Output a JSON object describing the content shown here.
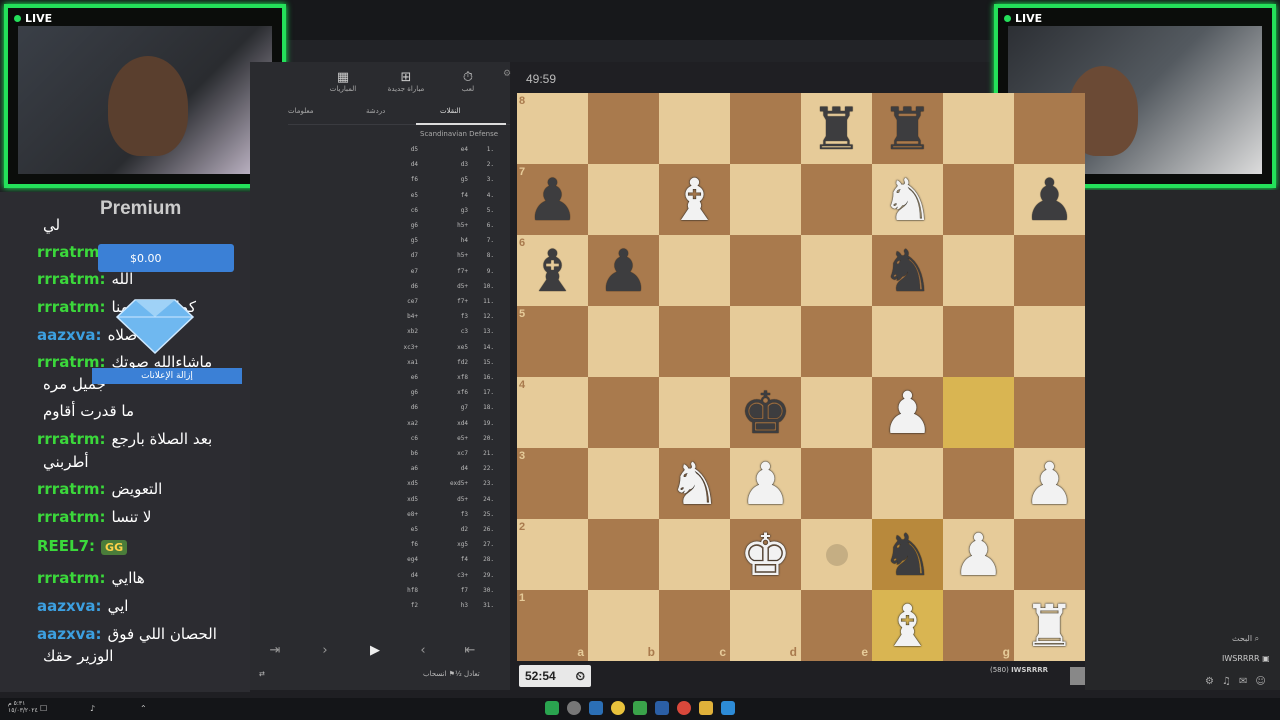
{
  "stream": {
    "live_label": "LIVE",
    "premium_label": "Premium"
  },
  "chat": {
    "messages": [
      {
        "user": "",
        "text": "لي"
      },
      {
        "user": "rrratrm:",
        "text": "تعويض"
      },
      {
        "user": "rrratrm:",
        "text": "الله"
      },
      {
        "user": "rrratrm:",
        "text": "كمل لا تحرمنا"
      },
      {
        "user": "aazxva:",
        "text": "صلاه"
      },
      {
        "user": "rrratrm:",
        "text": "ماشاءالله صوتك"
      },
      {
        "user": "",
        "text": "جميل مره"
      },
      {
        "user": "",
        "text": "ما قدرت أقاوم"
      },
      {
        "user": "rrratrm:",
        "text": "بعد الصلاة بارجع"
      },
      {
        "user": "",
        "text": "أطربني"
      },
      {
        "user": "rrratrm:",
        "text": "التعويض"
      },
      {
        "user": "rrratrm:",
        "text": "لا تنسا"
      },
      {
        "user": "REEL7:",
        "text": "GG"
      },
      {
        "user": "rrratrm:",
        "text": "هاايي"
      },
      {
        "user": "aazxva:",
        "text": "ايي"
      },
      {
        "user": "aazxva:",
        "text": "الحصان اللي فوق"
      },
      {
        "user": "",
        "text": "الوزير حقك"
      }
    ],
    "ad_price": "$0.00",
    "ad_remove": "إزالة الإعلانات"
  },
  "panel": {
    "tabs": [
      {
        "label": "لعب",
        "icon": "timer-icon"
      },
      {
        "label": "مباراة جديدة",
        "icon": "plus-icon"
      },
      {
        "label": "المباريات",
        "icon": "grid-icon"
      }
    ],
    "subtabs": [
      "النقلات",
      "دردشة",
      "معلومات"
    ],
    "opening": "Scandinavian Defense",
    "moves": [
      {
        "n": "1.",
        "w": "e4",
        "b": "d5"
      },
      {
        "n": "2.",
        "w": "d3",
        "b": "d4"
      },
      {
        "n": "3.",
        "w": "g5",
        "b": "f6"
      },
      {
        "n": "4.",
        "w": "f4",
        "b": "e5"
      },
      {
        "n": "5.",
        "w": "g3",
        "b": "c6"
      },
      {
        "n": "6.",
        "w": "h5+",
        "b": "g6"
      },
      {
        "n": "7.",
        "w": "h4",
        "b": "g5"
      },
      {
        "n": "8.",
        "w": "h5+",
        "b": "d7"
      },
      {
        "n": "9.",
        "w": "f7+",
        "b": "e7"
      },
      {
        "n": "10.",
        "w": "d5+",
        "b": "d6"
      },
      {
        "n": "11.",
        "w": "f7+",
        "b": "ce7"
      },
      {
        "n": "12.",
        "w": "f3",
        "b": "b4+"
      },
      {
        "n": "13.",
        "w": "c3",
        "b": "xb2"
      },
      {
        "n": "14.",
        "w": "xe5",
        "b": "xc3+"
      },
      {
        "n": "15.",
        "w": "fd2",
        "b": "xa1"
      },
      {
        "n": "16.",
        "w": "xf8",
        "b": "e6"
      },
      {
        "n": "17.",
        "w": "xf6",
        "b": "g6"
      },
      {
        "n": "18.",
        "w": "g7",
        "b": "d6"
      },
      {
        "n": "19.",
        "w": "xd4",
        "b": "xa2"
      },
      {
        "n": "20.",
        "w": "e5+",
        "b": "c6"
      },
      {
        "n": "21.",
        "w": "xc7",
        "b": "b6"
      },
      {
        "n": "22.",
        "w": "d4",
        "b": "a6"
      },
      {
        "n": "23.",
        "w": "exd5+",
        "b": "xd5"
      },
      {
        "n": "24.",
        "w": "d5+",
        "b": "xd5"
      },
      {
        "n": "25.",
        "w": "f3",
        "b": "e8+"
      },
      {
        "n": "26.",
        "w": "d2",
        "b": "e5"
      },
      {
        "n": "27.",
        "w": "xg5",
        "b": "f6"
      },
      {
        "n": "28.",
        "w": "f4",
        "b": "eg4"
      },
      {
        "n": "29.",
        "w": "c3+",
        "b": "d4"
      },
      {
        "n": "30.",
        "w": "f7",
        "b": "hf8"
      },
      {
        "n": "31.",
        "w": "h3",
        "b": "f2"
      }
    ],
    "bottom": {
      "draw": "½ تعادل",
      "resign": "انسحاب"
    }
  },
  "game": {
    "timer_top": "49:59",
    "timer_bottom": "52:54",
    "player_name": "IWSRRRR",
    "player_rating": "(580)",
    "board": [
      [
        "",
        "",
        "",
        "",
        "bR",
        "bR",
        "",
        ""
      ],
      [
        "bP",
        "",
        "wB",
        "",
        "",
        "wN",
        "",
        "bP"
      ],
      [
        "bB",
        "bP",
        "",
        "",
        "",
        "bN",
        "",
        ""
      ],
      [
        "",
        "",
        "",
        "",
        "",
        "",
        "",
        ""
      ],
      [
        "",
        "",
        "",
        "bK",
        "",
        "wP",
        "",
        ""
      ],
      [
        "",
        "",
        "wN",
        "wP",
        "",
        "",
        "",
        "wP"
      ],
      [
        "",
        "",
        "",
        "wK",
        "",
        "bN",
        "wP",
        ""
      ],
      [
        "",
        "",
        "",
        "",
        "",
        "wB",
        "",
        "wR"
      ]
    ],
    "highlight": {
      "light": [
        "g4",
        "f1"
      ],
      "dark": [
        "f2"
      ]
    },
    "hint": "e2",
    "ranks": [
      "8",
      "7",
      "6",
      "5",
      "4",
      "3",
      "2",
      "1"
    ],
    "files": [
      "a",
      "b",
      "c",
      "d",
      "e",
      "f",
      "g",
      "h"
    ],
    "visible_files": [
      "a",
      "b",
      "c",
      "d",
      "e",
      "",
      "g",
      ""
    ],
    "visible_ranks": [
      "8",
      "7",
      "6",
      "5",
      "4",
      "3",
      "2",
      "1"
    ]
  },
  "right": {
    "search": "البحث",
    "user": "IWSRRRR"
  },
  "taskbar": {
    "clock": "٥:٣١ م",
    "date": "١٥/٠٣/٢٠٢٤"
  }
}
